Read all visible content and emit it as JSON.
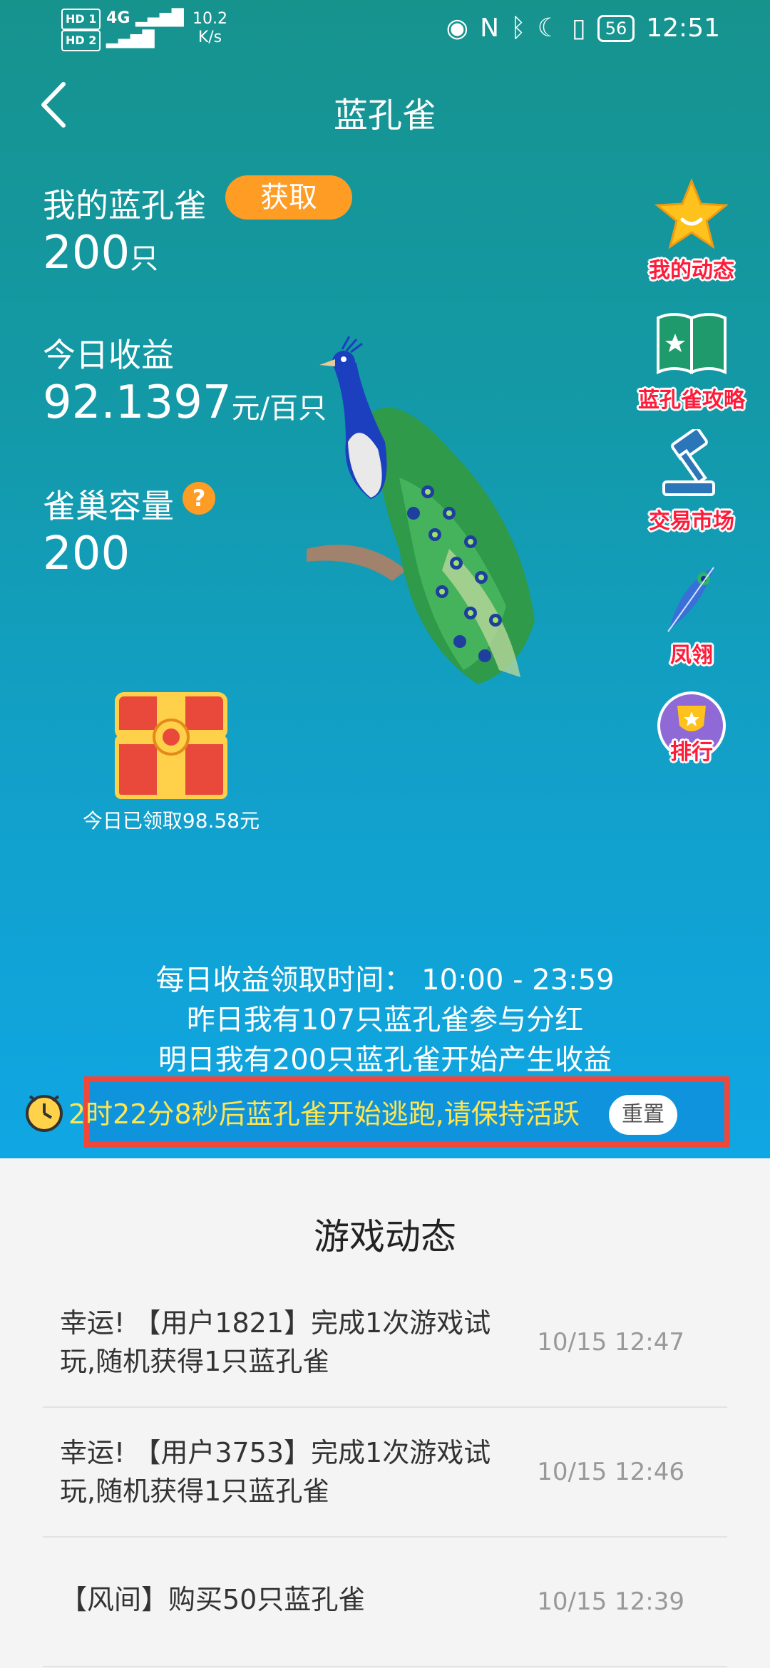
{
  "status_bar": {
    "sim1": "HD 1",
    "sim2": "HD 2",
    "signal": "4G",
    "speed_value": "10.2",
    "speed_unit": "K/s",
    "battery": "56",
    "time": "12:51"
  },
  "header": {
    "back_icon": "chevron-left-icon",
    "title": "蓝孔雀"
  },
  "stats": {
    "my_label": "我的蓝孔雀",
    "get_button": "获取",
    "my_count": "200",
    "my_unit": "只",
    "income_label": "今日收益",
    "income_value": "92.1397",
    "income_unit": "元/百只",
    "capacity_label": "雀巢容量",
    "capacity_help_icon": "question-icon",
    "capacity_value": "200"
  },
  "side_menu": [
    {
      "icon": "star-icon",
      "label": "我的动态"
    },
    {
      "icon": "book-icon",
      "label": "蓝孔雀攻略"
    },
    {
      "icon": "gavel-icon",
      "label": "交易市场"
    },
    {
      "icon": "feather-icon",
      "label": "凤翎"
    },
    {
      "icon": "trophy-icon",
      "label": "排行"
    }
  ],
  "chest": {
    "icon": "treasure-chest-icon",
    "label": "今日已领取98.58元"
  },
  "info_lines": [
    "每日收益领取时间：  10:00 - 23:59",
    "昨日我有107只蓝孔雀参与分红",
    "明日我有200只蓝孔雀开始产生收益"
  ],
  "countdown": {
    "icon": "alarm-clock-icon",
    "text": "2时22分8秒后蓝孔雀开始逃跑,请保持活跃",
    "reset_label": "重置"
  },
  "feed": {
    "title": "游戏动态",
    "items": [
      {
        "text": "幸运!  【用户1821】完成1次游戏试玩,随机获得1只蓝孔雀",
        "time": "10/15 12:47"
      },
      {
        "text": "幸运!  【用户3753】完成1次游戏试玩,随机获得1只蓝孔雀",
        "time": "10/15 12:46"
      },
      {
        "text": "【风间】购买50只蓝孔雀",
        "time": "10/15 12:39"
      }
    ]
  },
  "colors": {
    "accent_orange": "#ff9c24",
    "side_label_red": "#ff1c3a",
    "highlight_border": "#f0473b",
    "countdown_text": "#ffe64d"
  }
}
